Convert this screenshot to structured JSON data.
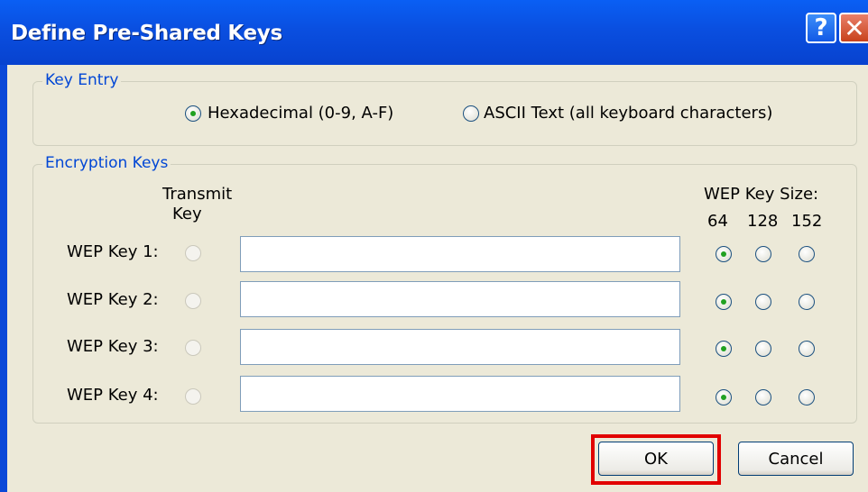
{
  "window": {
    "title": "Define Pre-Shared Keys"
  },
  "titlebar": {
    "help_label": "?",
    "close_label": "✕"
  },
  "key_entry": {
    "legend": "Key Entry",
    "options": [
      {
        "label": "Hexadecimal (0-9, A-F)",
        "selected": true
      },
      {
        "label": "ASCII Text (all keyboard characters)",
        "selected": false
      }
    ]
  },
  "encryption_keys": {
    "legend": "Encryption Keys",
    "transmit_header_line1": "Transmit",
    "transmit_header_line2": "Key",
    "size_header": "WEP Key Size:",
    "sizes": [
      "64",
      "128",
      "152"
    ],
    "keys": [
      {
        "label": "WEP Key 1:",
        "value": "",
        "selected_size": "64"
      },
      {
        "label": "WEP Key 2:",
        "value": "",
        "selected_size": "64"
      },
      {
        "label": "WEP Key 3:",
        "value": "",
        "selected_size": "64"
      },
      {
        "label": "WEP Key 4:",
        "value": "",
        "selected_size": "64"
      }
    ]
  },
  "buttons": {
    "ok": "OK",
    "cancel": "Cancel"
  },
  "colors": {
    "highlight": "#e10000",
    "titlebar": "#0a4fe0",
    "legend": "#0046d5"
  }
}
